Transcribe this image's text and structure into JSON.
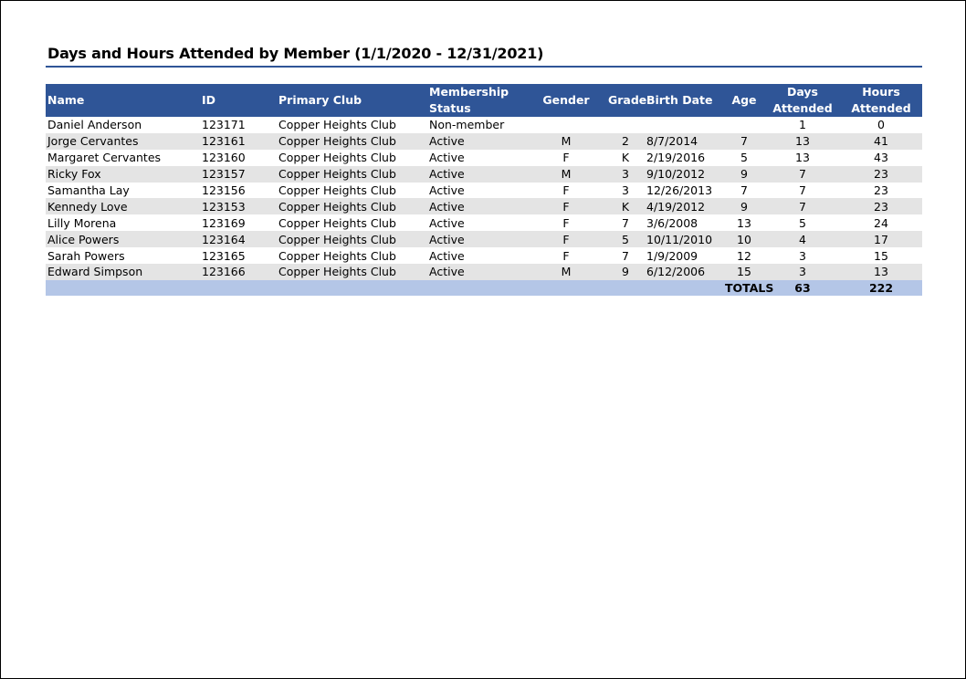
{
  "report": {
    "title": "Days and Hours Attended by Member (1/1/2020 - 12/31/2021)"
  },
  "table": {
    "headers": {
      "name": "Name",
      "id": "ID",
      "primary_club": "Primary Club",
      "membership_status_1": "Membership",
      "membership_status_2": "Status",
      "gender": "Gender",
      "grade": "Grade",
      "birth_date": "Birth Date",
      "age": "Age",
      "days_attended_1": "Days",
      "days_attended_2": "Attended",
      "hours_attended_1": "Hours",
      "hours_attended_2": "Attended"
    },
    "rows": [
      {
        "name": "Daniel Anderson",
        "id": "123171",
        "club": "Copper Heights Club",
        "status": "Non-member",
        "gender": "",
        "grade": "",
        "birth_date": "",
        "age": "",
        "days": "1",
        "hours": "0"
      },
      {
        "name": "Jorge Cervantes",
        "id": "123161",
        "club": "Copper Heights Club",
        "status": "Active",
        "gender": "M",
        "grade": "2",
        "birth_date": "8/7/2014",
        "age": "7",
        "days": "13",
        "hours": "41"
      },
      {
        "name": "Margaret Cervantes",
        "id": "123160",
        "club": "Copper Heights Club",
        "status": "Active",
        "gender": "F",
        "grade": "K",
        "birth_date": "2/19/2016",
        "age": "5",
        "days": "13",
        "hours": "43"
      },
      {
        "name": "Ricky Fox",
        "id": "123157",
        "club": "Copper Heights Club",
        "status": "Active",
        "gender": "M",
        "grade": "3",
        "birth_date": "9/10/2012",
        "age": "9",
        "days": "7",
        "hours": "23"
      },
      {
        "name": "Samantha Lay",
        "id": "123156",
        "club": "Copper Heights Club",
        "status": "Active",
        "gender": "F",
        "grade": "3",
        "birth_date": "12/26/2013",
        "age": "7",
        "days": "7",
        "hours": "23"
      },
      {
        "name": "Kennedy Love",
        "id": "123153",
        "club": "Copper Heights Club",
        "status": "Active",
        "gender": "F",
        "grade": "K",
        "birth_date": "4/19/2012",
        "age": "9",
        "days": "7",
        "hours": "23"
      },
      {
        "name": "Lilly Morena",
        "id": "123169",
        "club": "Copper Heights Club",
        "status": "Active",
        "gender": "F",
        "grade": "7",
        "birth_date": "3/6/2008",
        "age": "13",
        "days": "5",
        "hours": "24"
      },
      {
        "name": "Alice Powers",
        "id": "123164",
        "club": "Copper Heights Club",
        "status": "Active",
        "gender": "F",
        "grade": "5",
        "birth_date": "10/11/2010",
        "age": "10",
        "days": "4",
        "hours": "17"
      },
      {
        "name": "Sarah Powers",
        "id": "123165",
        "club": "Copper Heights Club",
        "status": "Active",
        "gender": "F",
        "grade": "7",
        "birth_date": "1/9/2009",
        "age": "12",
        "days": "3",
        "hours": "15"
      },
      {
        "name": "Edward Simpson",
        "id": "123166",
        "club": "Copper Heights Club",
        "status": "Active",
        "gender": "M",
        "grade": "9",
        "birth_date": "6/12/2006",
        "age": "15",
        "days": "3",
        "hours": "13"
      }
    ],
    "totals": {
      "label": "TOTALS",
      "days": "63",
      "hours": "222"
    }
  },
  "colors": {
    "header_bg": "#2f5597",
    "header_text": "#ffffff",
    "band_bg": "#e4e4e4",
    "totals_bg": "#b4c6e7",
    "title_rule": "#2f5597"
  }
}
